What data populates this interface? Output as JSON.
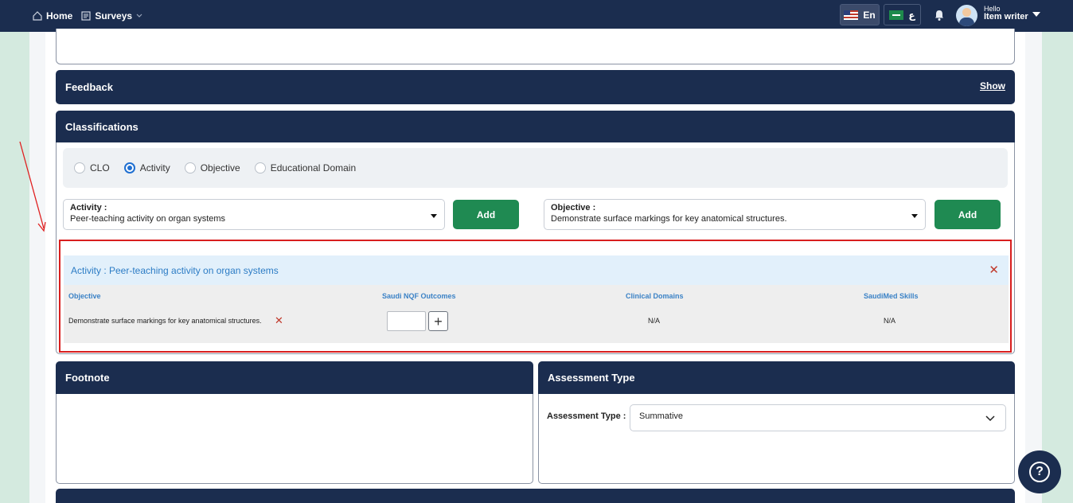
{
  "nav": {
    "home_label": "Home",
    "surveys_label": "Surveys",
    "lang_en": "En",
    "lang_ar": "ع",
    "greeting": "Hello",
    "user_name": "Item writer"
  },
  "feedback": {
    "title": "Feedback",
    "toggle_label": "Show"
  },
  "classifications": {
    "title": "Classifications",
    "radios": [
      {
        "label": "CLO",
        "checked": false
      },
      {
        "label": "Activity",
        "checked": true
      },
      {
        "label": "Objective",
        "checked": false
      },
      {
        "label": "Educational Domain",
        "checked": false
      }
    ],
    "activity_select": {
      "label": "Activity :",
      "value": "Peer-teaching activity on organ systems"
    },
    "objective_select": {
      "label": "Objective :",
      "value": "Demonstrate surface markings for key anatomical structures."
    },
    "add_label": "Add",
    "result": {
      "header": "Activity : Peer-teaching activity on organ systems",
      "columns": [
        "Objective",
        "Saudi NQF Outcomes",
        "Clinical Domains",
        "SaudiMed Skills"
      ],
      "row": {
        "objective": "Demonstrate surface markings for key anatomical structures.",
        "clinical_domains": "N/A",
        "saudimed_skills": "N/A"
      }
    }
  },
  "footnote": {
    "title": "Footnote"
  },
  "assessment": {
    "title": "Assessment Type",
    "label": "Assessment Type :",
    "value": "Summative"
  },
  "colors": {
    "navy": "#1b2d4f",
    "green": "#1f8a52",
    "highlight_red": "#d81e1e",
    "link_blue": "#3b82c6"
  }
}
